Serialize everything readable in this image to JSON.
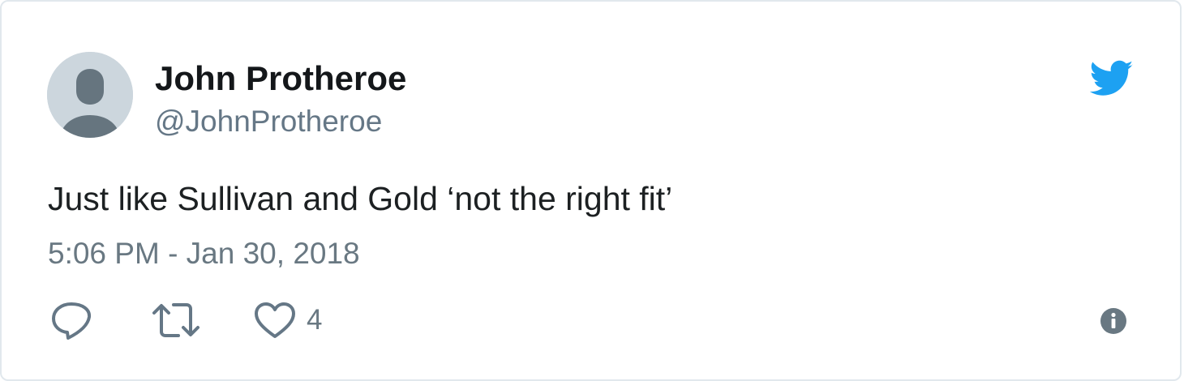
{
  "tweet": {
    "author_name": "John Protheroe",
    "author_handle": "@JohnProtheroe",
    "text": "Just like Sullivan and Gold ‘not the right fit’",
    "timestamp": "5:06 PM - Jan 30, 2018",
    "like_count": "4"
  },
  "icons": {
    "brand": "twitter-bird-icon",
    "reply": "reply-icon",
    "retweet": "retweet-icon",
    "like": "heart-icon",
    "info": "info-icon",
    "avatar": "default-avatar-icon"
  },
  "colors": {
    "brand_blue": "#1da1f2",
    "name_text": "#14171a",
    "secondary_text": "#657786",
    "action_gray": "#657786",
    "avatar_bg": "#ccd6dd",
    "avatar_silhouette": "#66757f"
  }
}
